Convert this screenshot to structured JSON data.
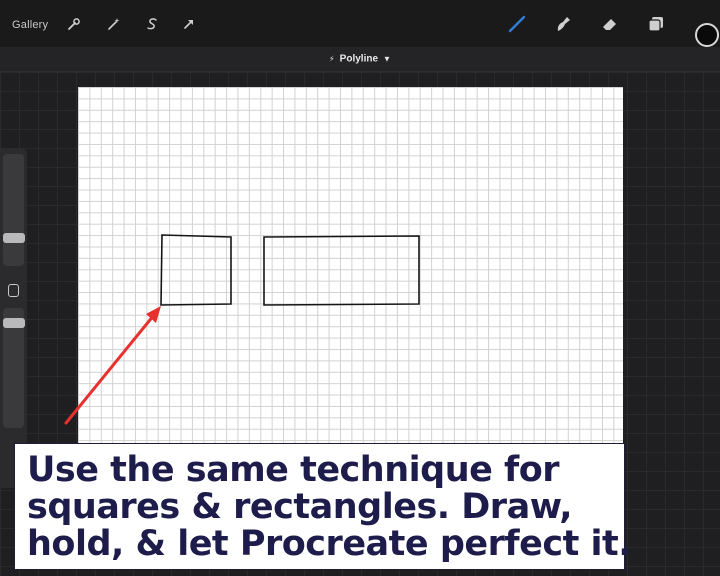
{
  "app": {
    "name": "Procreate",
    "accent_color": "#2f7dd6",
    "current_color": "#0a0a0a"
  },
  "toolbar": {
    "gallery_label": "Gallery",
    "left_icons": [
      "wrench-icon",
      "magic-wand-icon",
      "selection-icon",
      "transform-icon"
    ],
    "right_icons": [
      "brush-icon",
      "smudge-icon",
      "eraser-icon",
      "layers-icon",
      "color-swatch"
    ]
  },
  "shape_bar": {
    "label": "Polyline",
    "icons": [
      "bolt-icon",
      "chevron-down-icon"
    ]
  },
  "canvas": {
    "background": "#ffffff",
    "grid": true,
    "shapes": [
      "square",
      "rectangle"
    ]
  },
  "annotation": {
    "arrow_color": "#e8312f"
  },
  "caption": {
    "lines": [
      "Use the same technique for",
      "squares & rectangles. Draw,",
      "hold, & let Procreate perfect it."
    ],
    "text_color": "#1d1c4a"
  }
}
